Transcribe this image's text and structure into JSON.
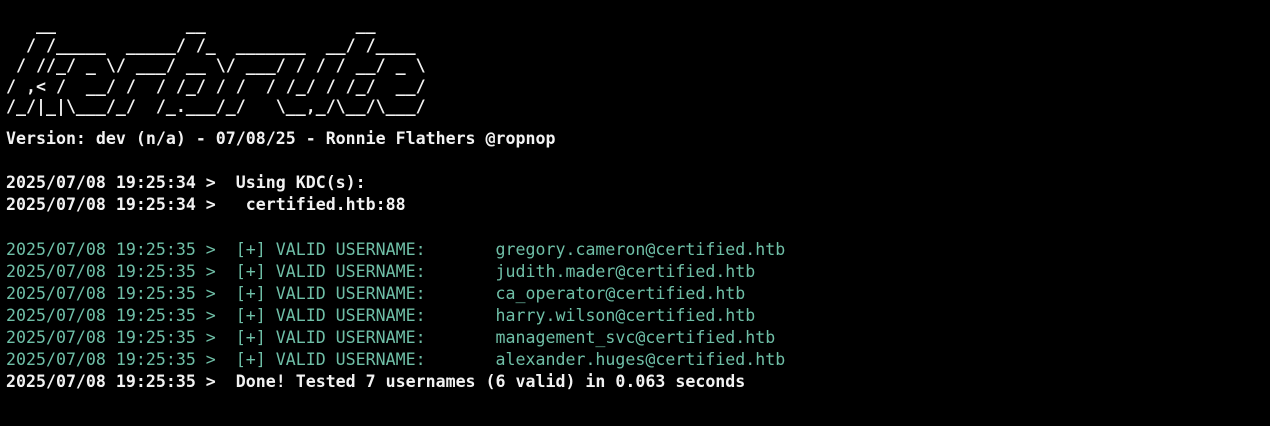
{
  "banner": "   __             __               __     \n  / /_____  _____/ /_  _______  __/ /____ \n / //_/ _ \\/ ___/ __ \\/ ___/ / / / __/ _ \\\n/ ,< /  __/ /  / /_/ / /  / /_/ / /_/  __/\n/_/|_|\\___/_/  /_.___/_/   \\__,_/\\__/\\___/",
  "version_line": "Version: dev (n/a) - 07/08/25 - Ronnie Flathers @ropnop",
  "kdc_lines": [
    "2025/07/08 19:25:34 >  Using KDC(s):",
    "2025/07/08 19:25:34 >   certified.htb:88"
  ],
  "valid_users": [
    {
      "prefix": "2025/07/08 19:25:35 >  [+] VALID USERNAME:",
      "user": "gregory.cameron@certified.htb"
    },
    {
      "prefix": "2025/07/08 19:25:35 >  [+] VALID USERNAME:",
      "user": "judith.mader@certified.htb"
    },
    {
      "prefix": "2025/07/08 19:25:35 >  [+] VALID USERNAME:",
      "user": "ca_operator@certified.htb"
    },
    {
      "prefix": "2025/07/08 19:25:35 >  [+] VALID USERNAME:",
      "user": "harry.wilson@certified.htb"
    },
    {
      "prefix": "2025/07/08 19:25:35 >  [+] VALID USERNAME:",
      "user": "management_svc@certified.htb"
    },
    {
      "prefix": "2025/07/08 19:25:35 >  [+] VALID USERNAME:",
      "user": "alexander.huges@certified.htb"
    }
  ],
  "done_line": "2025/07/08 19:25:35 >  Done! Tested 7 usernames (6 valid) in 0.063 seconds",
  "colors": {
    "background": "#000000",
    "text": "#f2f2f2",
    "success": "#6fbfa7"
  }
}
